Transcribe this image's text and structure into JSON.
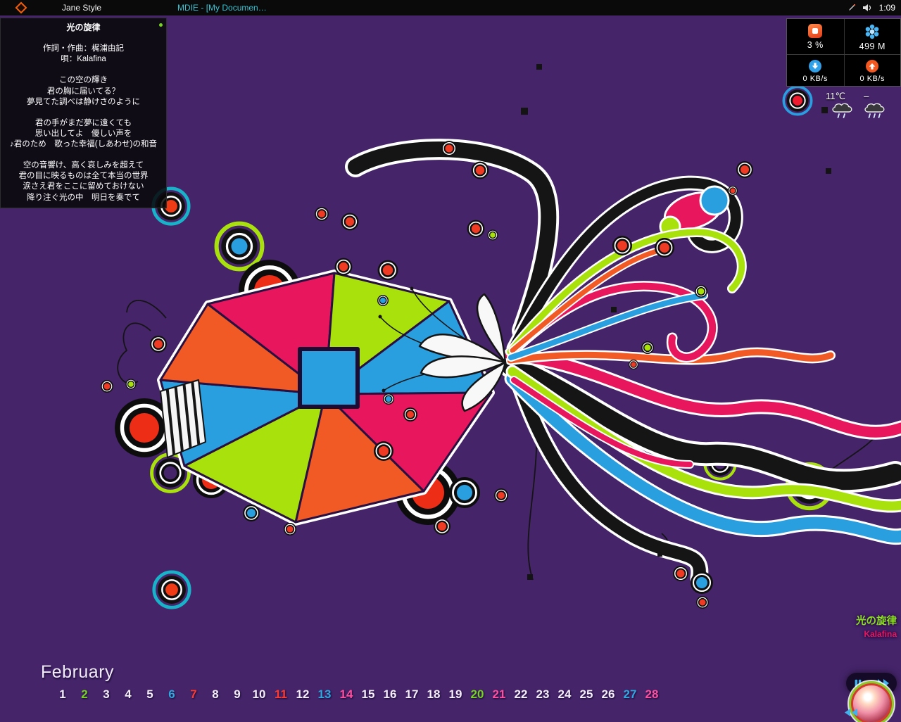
{
  "taskbar": {
    "jane_label": "Jane Style",
    "mdie_label": "MDIE - [My Documen…",
    "clock": "1:09"
  },
  "lyrics": {
    "lines": [
      "光の旋律",
      "",
      "作詞・作曲：梶浦由記",
      "唄：Kalafina",
      "",
      "この空の輝き",
      "君の胸に届いてる？",
      "夢見てた調べは静けさのように",
      "",
      "君の手がまだ夢に遠くても",
      "思い出してよ　優しい声を",
      "♪君のため　歌った幸福(しあわせ)の和音",
      "",
      "空の音響け、高く哀しみを超えて",
      "君の目に映るものは全て本当の世界",
      "涙さえ君をここに留めておけない",
      "降り注ぐ光の中　明日を奏でて"
    ]
  },
  "system_monitor": {
    "cpu": "3 %",
    "memory": "499 M",
    "download": "0 KB/s",
    "upload": "0 KB/s"
  },
  "weather": {
    "temperature": "11℃",
    "tomorrow": "–"
  },
  "now_playing": {
    "title": "光の旋律",
    "artist": "Kalafina"
  },
  "calendar": {
    "month": "February",
    "days": [
      {
        "d": "1",
        "c": "#f5eefc"
      },
      {
        "d": "2",
        "c": "#74d41e"
      },
      {
        "d": "3",
        "c": "#f5eefc"
      },
      {
        "d": "4",
        "c": "#f5eefc"
      },
      {
        "d": "5",
        "c": "#f5eefc"
      },
      {
        "d": "6",
        "c": "#2fa8e0"
      },
      {
        "d": "7",
        "c": "#ff3b30"
      },
      {
        "d": "8",
        "c": "#f5eefc"
      },
      {
        "d": "9",
        "c": "#f5eefc"
      },
      {
        "d": "10",
        "c": "#f5eefc"
      },
      {
        "d": "11",
        "c": "#ff3b30"
      },
      {
        "d": "12",
        "c": "#f5eefc"
      },
      {
        "d": "13",
        "c": "#2fa8e0"
      },
      {
        "d": "14",
        "c": "#ff4f9e"
      },
      {
        "d": "15",
        "c": "#f5eefc"
      },
      {
        "d": "16",
        "c": "#f5eefc"
      },
      {
        "d": "17",
        "c": "#f5eefc"
      },
      {
        "d": "18",
        "c": "#f5eefc"
      },
      {
        "d": "19",
        "c": "#f5eefc"
      },
      {
        "d": "20",
        "c": "#74d41e"
      },
      {
        "d": "21",
        "c": "#ff4f9e"
      },
      {
        "d": "22",
        "c": "#f5eefc"
      },
      {
        "d": "23",
        "c": "#f5eefc"
      },
      {
        "d": "24",
        "c": "#f5eefc"
      },
      {
        "d": "25",
        "c": "#f5eefc"
      },
      {
        "d": "26",
        "c": "#f5eefc"
      },
      {
        "d": "27",
        "c": "#2fa8e0"
      },
      {
        "d": "28",
        "c": "#ff4f9e"
      }
    ]
  },
  "palette": {
    "desktop_background": "#45246a",
    "art_pink": "#e8175d",
    "art_lime": "#a8e10c",
    "art_cyan": "#2a9fe0",
    "art_orange": "#f15a24",
    "art_black": "#151515"
  }
}
